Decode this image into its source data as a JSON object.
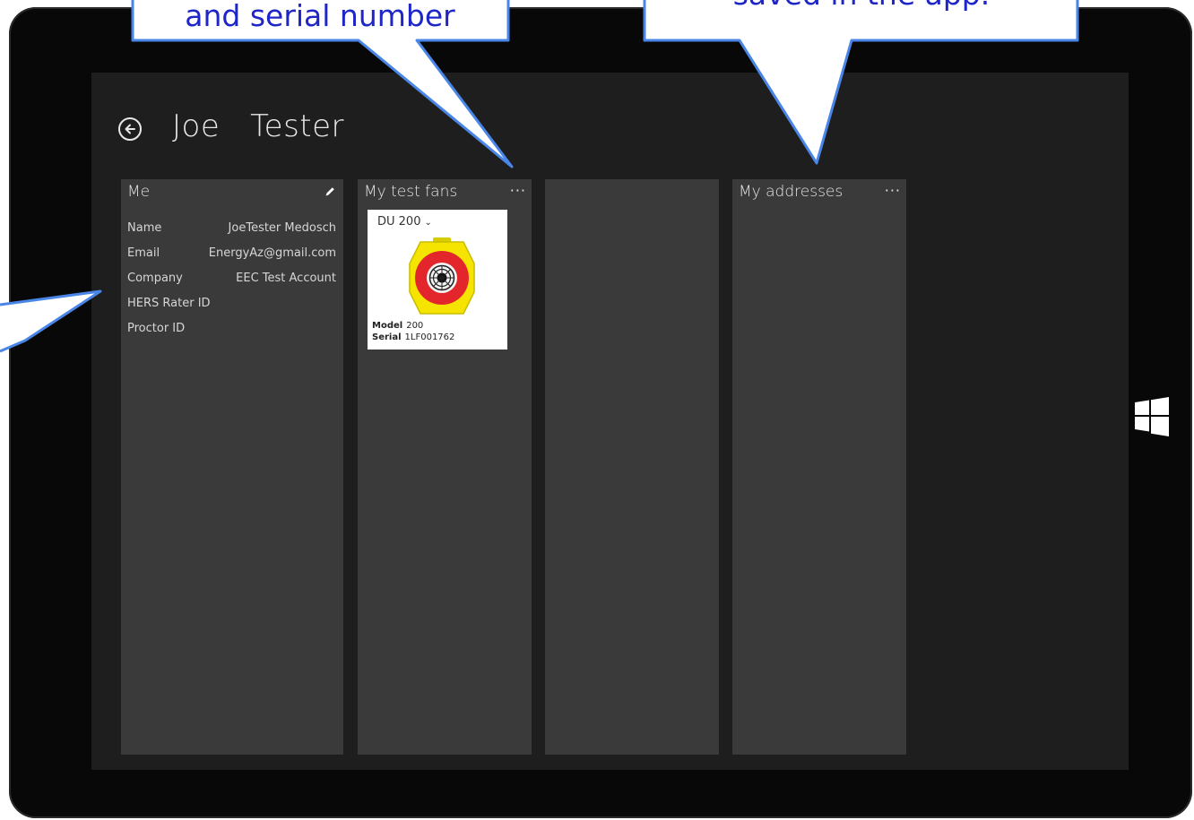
{
  "app": {
    "page_title": "Joe   Tester"
  },
  "panels": {
    "me": {
      "header": "Me",
      "fields": [
        {
          "label": "Name",
          "value": "JoeTester Medosch"
        },
        {
          "label": "Email",
          "value": "EnergyAz@gmail.com"
        },
        {
          "label": "Company",
          "value": "EEC Test Account"
        },
        {
          "label": "HERS Rater ID",
          "value": ""
        },
        {
          "label": "Proctor ID",
          "value": ""
        }
      ]
    },
    "test_fans": {
      "header": "My test fans",
      "more": "···",
      "fan": {
        "model_select": "DU 200",
        "model_label": "Model",
        "model_value": "200",
        "serial_label": "Serial",
        "serial_value": "1LF001762"
      }
    },
    "addresses": {
      "header": "My addresses",
      "more": "···"
    }
  },
  "callouts": {
    "left_text": "and serial number",
    "right_text": "saved in the app."
  },
  "colors": {
    "callout_fill": "#ffffff",
    "callout_border": "#4a86e8",
    "callout_text": "#1f26c8",
    "screen_bg": "#1e1e1e",
    "panel_bg": "#3a3a3a",
    "fan_yellow": "#f5e400",
    "fan_red": "#e3262c"
  },
  "icons": [
    "back-arrow-icon",
    "pencil-icon",
    "chevron-down-icon",
    "more-icon",
    "windows-logo-icon"
  ]
}
